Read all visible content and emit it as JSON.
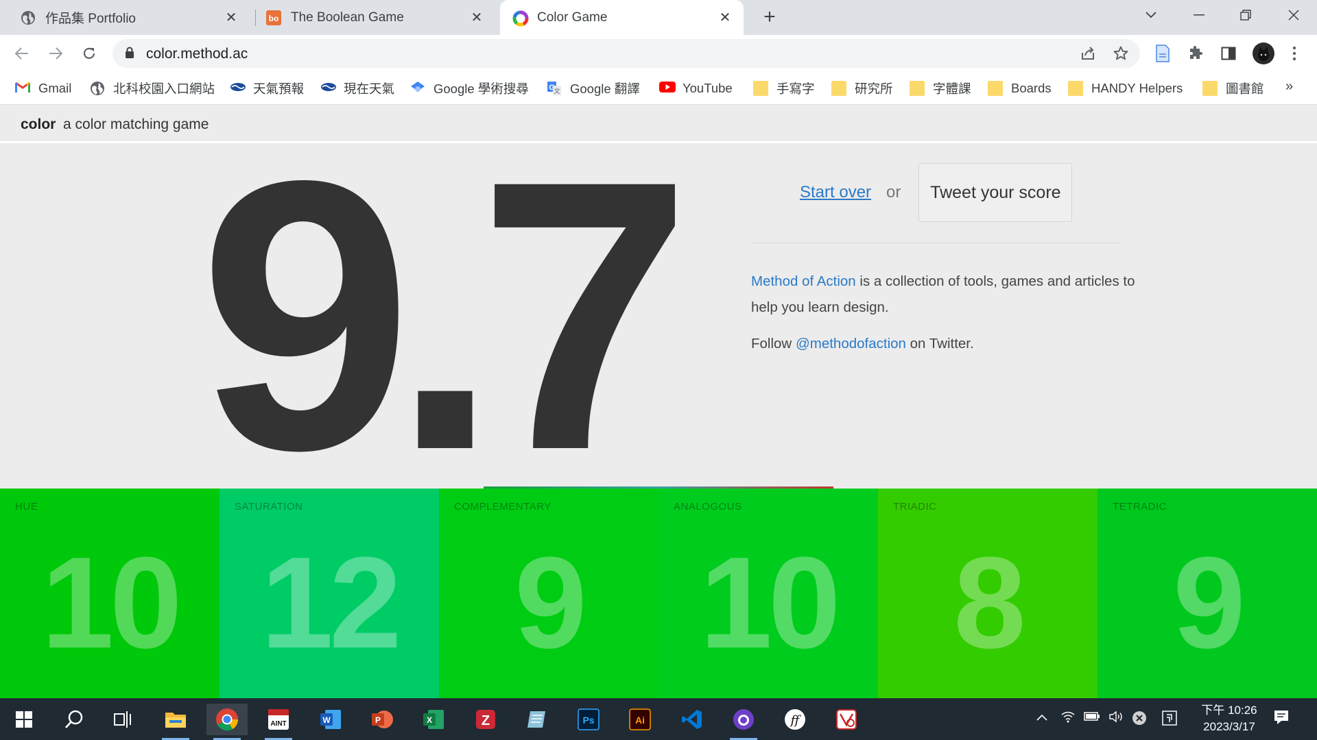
{
  "browser": {
    "tabs": [
      {
        "title": "作品集 Portfolio",
        "icon": "globe-icon",
        "active": false
      },
      {
        "title": "The Boolean Game",
        "icon": "boolean-game-favicon",
        "active": false
      },
      {
        "title": "Color Game",
        "icon": "color-game-favicon",
        "active": true
      }
    ],
    "close_glyph": "✕",
    "new_tab_glyph": "+",
    "url": "color.method.ac",
    "bookmarks": [
      {
        "label": "Gmail",
        "icon": "gmail-icon"
      },
      {
        "label": "北科校園入口網站",
        "icon": "globe-icon"
      },
      {
        "label": "天氣預報",
        "icon": "weather-icon"
      },
      {
        "label": "現在天氣",
        "icon": "weather-icon"
      },
      {
        "label": "Google 學術搜尋",
        "icon": "scholar-icon"
      },
      {
        "label": "Google 翻譯",
        "icon": "translate-icon"
      },
      {
        "label": "YouTube",
        "icon": "youtube-icon"
      },
      {
        "label": "手寫字",
        "icon": "folder-icon"
      },
      {
        "label": "研究所",
        "icon": "folder-icon"
      },
      {
        "label": "字體課",
        "icon": "folder-icon"
      },
      {
        "label": "Boards",
        "icon": "folder-icon"
      },
      {
        "label": "HANDY Helpers",
        "icon": "folder-icon"
      },
      {
        "label": "圖書館",
        "icon": "folder-icon"
      }
    ],
    "bookmarks_overflow": "»"
  },
  "site": {
    "name": "color",
    "tagline": "a color matching game"
  },
  "result": {
    "score": "9.7",
    "start_over": "Start over",
    "or": "or",
    "tweet": "Tweet your score",
    "about_link": "Method of Action",
    "about_text": " is a collection of tools, games and articles to help you learn design.",
    "follow_prefix": "Follow ",
    "follow_handle": "@methodofaction",
    "follow_suffix": " on Twitter."
  },
  "tiles": [
    {
      "label": "HUE",
      "value": "10",
      "color": "#00c80a"
    },
    {
      "label": "SATURATION",
      "value": "12",
      "color": "#00cc66"
    },
    {
      "label": "COMPLEMENTARY",
      "value": "9",
      "color": "#00cc14"
    },
    {
      "label": "ANALOGOUS",
      "value": "10",
      "color": "#00cc1e"
    },
    {
      "label": "TRIADIC",
      "value": "8",
      "color": "#33cc00"
    },
    {
      "label": "TETRADIC",
      "value": "9",
      "color": "#00c81e"
    }
  ],
  "taskbar": {
    "apps": [
      "start-icon",
      "search-icon",
      "task-view-icon",
      "file-explorer-icon",
      "chrome-icon",
      "paint-icon",
      "word-icon",
      "powerpoint-icon",
      "excel-icon",
      "zotero-icon",
      "notes-icon",
      "photoshop-icon",
      "illustrator-icon",
      "vscode-icon",
      "github-desktop-icon",
      "fontforge-icon",
      "app-icon"
    ],
    "clock_time": "下午 10:26",
    "clock_date": "2023/3/17"
  },
  "colors": {
    "score_text": "#333333",
    "link": "#2a7ac8",
    "page_bg": "#ececec"
  }
}
